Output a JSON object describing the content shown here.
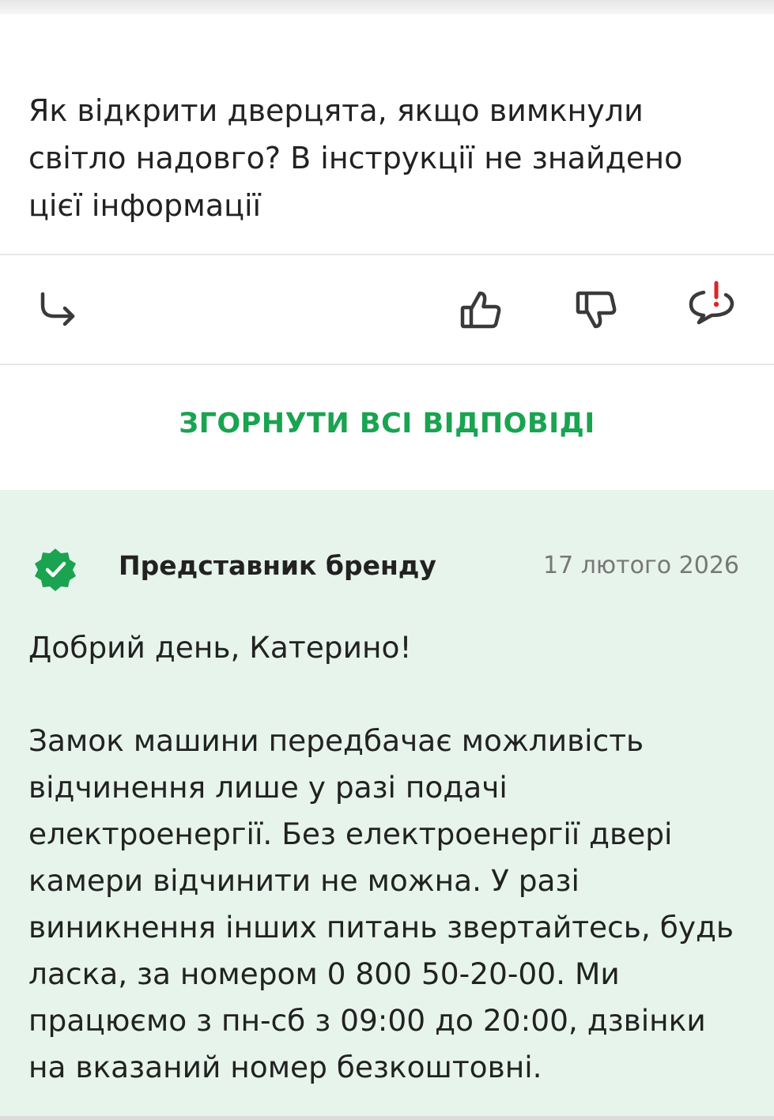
{
  "question": {
    "text": "Як відкрити дверцята, якщо вимкнули світло надовго? В інструкції не знайдено цієї інформації"
  },
  "actions": {
    "reply_icon": "reply-arrow-icon",
    "like_icon": "thumbs-up-icon",
    "dislike_icon": "thumbs-down-icon",
    "report_icon": "report-icon"
  },
  "collapse_label": "ЗГОРНУТИ ВСІ ВІДПОВІДІ",
  "answer": {
    "author": "Представник бренду",
    "date": "17 лютого 2026",
    "verified_icon": "verified-badge-icon",
    "body": "Добрий день, Катерино!\n\nЗамок машини передбачає можливість відчинення лише у разі подачі електроенергії. Без електроенергії двері камери відчинити не можна. У разі виникнення інших питань звертайтесь, будь ласка, за номером 0 800 50-20-00. Ми працюємо з пн-сб з 09:00 до 20:00, дзвінки на вказаний номер безкоштовні."
  },
  "colors": {
    "accent_green": "#1aa350",
    "answer_background": "#e7f4ec",
    "report_red": "#e02424"
  }
}
